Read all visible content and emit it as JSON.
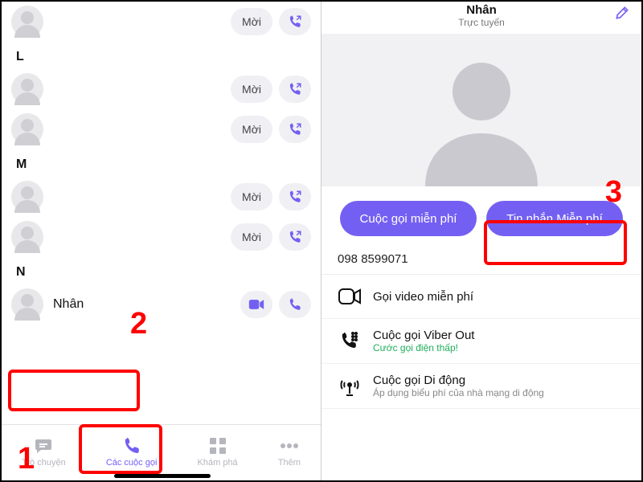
{
  "left": {
    "sections": [
      {
        "letter": "",
        "rows": [
          {
            "name": "",
            "invite": "Mời",
            "has_video": false
          }
        ]
      },
      {
        "letter": "L",
        "rows": [
          {
            "name": "",
            "invite": "Mời",
            "has_video": false
          },
          {
            "name": "",
            "invite": "Mời",
            "has_video": false
          }
        ]
      },
      {
        "letter": "M",
        "rows": [
          {
            "name": "",
            "invite": "Mời",
            "has_video": false
          },
          {
            "name": "",
            "invite": "Mời",
            "has_video": false
          }
        ]
      },
      {
        "letter": "N",
        "rows": [
          {
            "name": "Nhân",
            "invite": "",
            "has_video": true
          }
        ]
      }
    ],
    "tabs": {
      "chat": "Trò chuyện",
      "calls": "Các cuộc gọi",
      "discover": "Khám phá",
      "more": "Thêm"
    }
  },
  "right": {
    "title": "Nhân",
    "status": "Trực tuyến",
    "cta_call": "Cuộc gọi miễn phí",
    "cta_msg": "Tin nhắn Miễn phí",
    "phone": "098 8599071",
    "options": [
      {
        "icon": "video",
        "t1": "Gọi video miễn phí",
        "t2": ""
      },
      {
        "icon": "viberout",
        "t1": "Cuộc gọi Viber Out",
        "t2": "Cước gọi điện thấp!",
        "green": true
      },
      {
        "icon": "mobile",
        "t1": "Cuộc gọi Di động",
        "t2": "Áp dụng biểu phí của nhà mạng di động"
      }
    ]
  },
  "annotations": {
    "n1": "1",
    "n2": "2",
    "n3": "3"
  }
}
